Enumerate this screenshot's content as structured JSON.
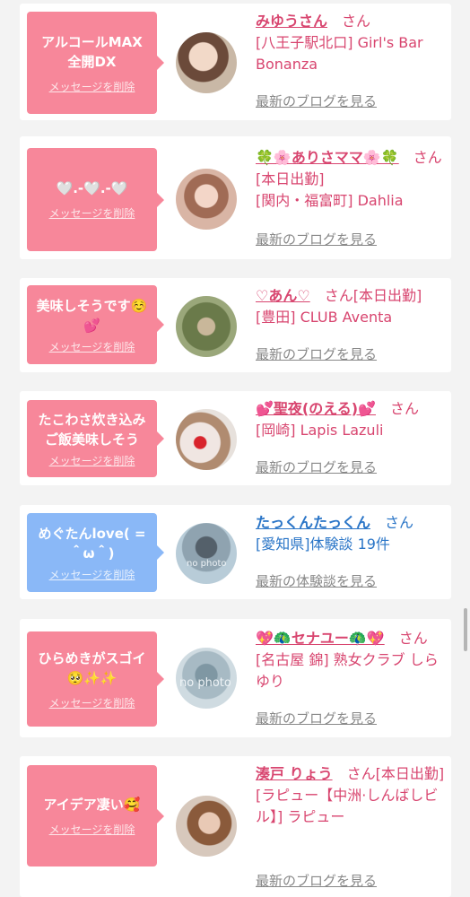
{
  "cards": [
    {
      "message": "アルコールMAX\n全開DX",
      "delete_label": "メッセージを削除",
      "name": "みゆうさん",
      "suffix": "さん",
      "shop": "[八王子駅北口] Girl's Bar Bonanza",
      "link": "最新のブログを見る",
      "bubble_color": "#f7879a"
    },
    {
      "message": "🤍.-🤍.-🤍",
      "delete_label": "メッセージを削除",
      "name": "🍀🌸ありさママ🌸🍀",
      "suffix": "さん",
      "status": "[本日出勤]",
      "shop": "[関内・福富町] Dahlia",
      "link": "最新のブログを見る",
      "bubble_color": "#f7879a"
    },
    {
      "message": "美味しそうです☺️\n💕",
      "delete_label": "メッセージを削除",
      "name": "♡あん♡",
      "suffix": "さん[本日出勤]",
      "shop": "[豊田] CLUB Aventa",
      "link": "最新のブログを見る",
      "bubble_color": "#f7879a"
    },
    {
      "message": "たこわさ炊き込み\nご飯美味しそう",
      "delete_label": "メッセージを削除",
      "name": "💕聖夜(のえる)💕",
      "suffix": "さん",
      "shop": "[岡崎] Lapis Lazuli",
      "link": "最新のブログを見る",
      "bubble_color": "#f7879a"
    },
    {
      "message": "めぐたんlove( =\n＾ω＾)",
      "delete_label": "メッセージを削除",
      "name": "たっくんたっくん",
      "suffix": "さん",
      "shop": "[愛知県]体験談 19件",
      "link": "最新の体験談を見る",
      "bubble_color": "#8ab8f7"
    },
    {
      "message": "ひらめきがスゴイ\n🥺✨✨",
      "delete_label": "メッセージを削除",
      "name": "💖🦚セナユー🦚💖",
      "suffix": "さん",
      "shop": "[名古屋 錦] 熟女クラブ しらゆり",
      "link": "最新のブログを見る",
      "bubble_color": "#f7879a"
    },
    {
      "message": "アイデア凄い🥰",
      "delete_label": "メッセージを削除",
      "name": "湊戸 りょう",
      "suffix": "さん[本日出勤]",
      "shop": "[ラピュー【中洲·しんばしビル】] ラピュー",
      "link": "最新のブログを見る",
      "bubble_color": "#f7879a"
    }
  ],
  "no_photo_label": "no photo"
}
